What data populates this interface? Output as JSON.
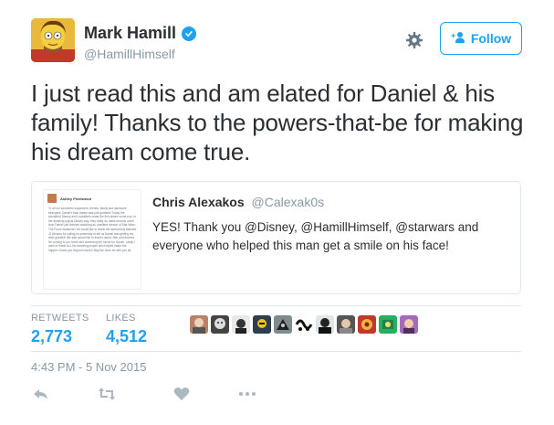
{
  "author": {
    "display_name": "Mark Hamill",
    "handle": "@HamillHimself"
  },
  "header": {
    "follow_label": "Follow"
  },
  "tweet": {
    "text": "I just read this and am elated for Daniel & his family! Thanks to the powers-that-be for making his dream come true.",
    "timestamp": "4:43 PM - 5 Nov 2015"
  },
  "quoted": {
    "name": "Chris Alexakos",
    "handle": "@Calexak0s",
    "text": "YES! Thank you @Disney, @HamillHimself, @starwars and everyone who helped this man get a smile on his face!",
    "thumb_author": "Ashley Fleetwood",
    "thumb_body": "To all our wonderful supporters, friends, family and awesome strangers: Daniel's final dream was just granted!! Today the wonderful Disney and Lucasfilms made the first dream come true, in the amazing typical Disney way, they really do make dreams come true! Daniel just finished watching an unedited version of Star Wars: The Force Awakens!! He would like to thank the awesomely talented JJ Abrams for calling us yesterday to tell us Daniel was getting his wish granted! We also would like to thank Lianna, Ben and Andrew for coming to our home and screening the movie for Daniel. Lastly I want to thank ALL the amazing people who helped make this happen, thank you beyond words!! May the force be with you all"
  },
  "stats": {
    "retweets_label": "RETWEETS",
    "retweets_value": "2,773",
    "likes_label": "LIKES",
    "likes_value": "4,512"
  },
  "icons": {
    "gear": "gear-icon",
    "follow": "add-user-icon",
    "verified": "verified-badge-icon",
    "reply": "reply-icon",
    "retweet": "retweet-icon",
    "like": "heart-icon",
    "more": "more-icon"
  },
  "colors": {
    "accent": "#1da1f2",
    "muted": "#8899a6",
    "icon": "#aab8c2",
    "text": "#292f33"
  }
}
